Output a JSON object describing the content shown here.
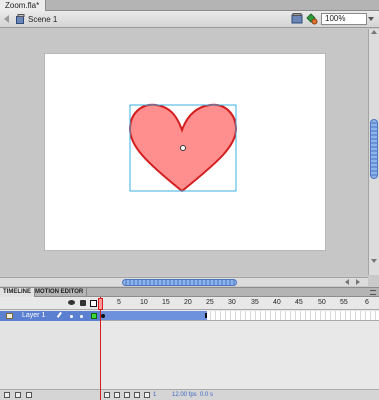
{
  "document": {
    "tab_label": "Zoom.fla*"
  },
  "edit_bar": {
    "scene_label": "Scene 1",
    "zoom_value": "100%"
  },
  "panels": {
    "tabs": [
      "TIMELINE",
      "MOTION EDITOR"
    ]
  },
  "timeline": {
    "frame_numbers": [
      "5",
      "10",
      "15",
      "20",
      "25",
      "30",
      "35",
      "40",
      "45",
      "50",
      "55",
      "6"
    ],
    "layers": [
      {
        "name": "Layer 1"
      }
    ],
    "status": {
      "current_frame": "1",
      "frame_rate": "12.00 fps",
      "elapsed": "0.0 s"
    }
  },
  "colors": {
    "heart_fill": "#ff8f8f",
    "heart_stroke": "#d41e1e",
    "selection_box": "#3ab0e0",
    "layer_selected": "#5b7fd1",
    "playhead": "#d41e1e"
  }
}
